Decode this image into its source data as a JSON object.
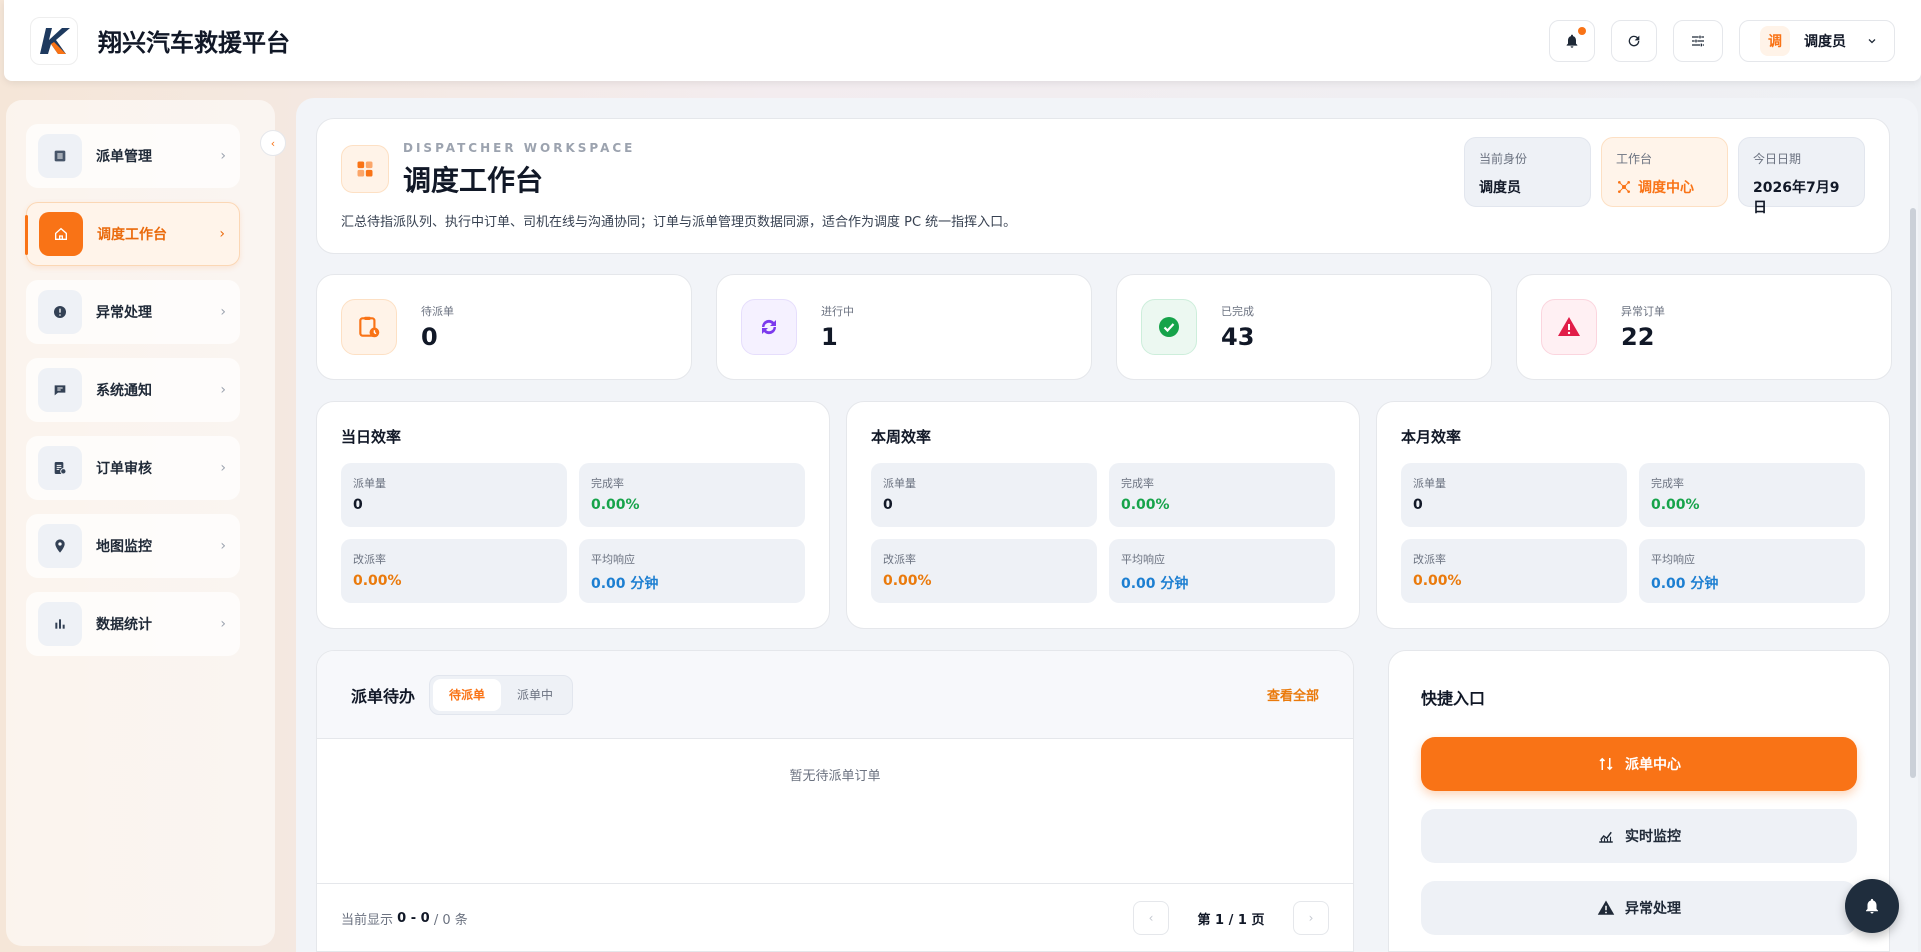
{
  "app": {
    "title": "翔兴汽车救援平台",
    "logo_text": "K"
  },
  "topbar": {
    "user_avatar": "调",
    "user_name": "调度员"
  },
  "sidebar": {
    "items": [
      {
        "label": "派单管理",
        "icon": "list-icon",
        "active": false
      },
      {
        "label": "调度工作台",
        "icon": "home-icon",
        "active": true
      },
      {
        "label": "异常处理",
        "icon": "alert-icon",
        "active": false
      },
      {
        "label": "系统通知",
        "icon": "notice-icon",
        "active": false
      },
      {
        "label": "订单审核",
        "icon": "review-icon",
        "active": false
      },
      {
        "label": "地图监控",
        "icon": "location-icon",
        "active": false
      },
      {
        "label": "数据统计",
        "icon": "bar-chart-icon",
        "active": false
      }
    ]
  },
  "header": {
    "eyebrow": "DISPATCHER WORKSPACE",
    "title": "调度工作台",
    "description": "汇总待指派队列、执行中订单、司机在线与沟通协同；订单与派单管理页数据同源，适合作为调度 PC 统一指挥入口。",
    "tiles": [
      {
        "label": "当前身份",
        "value": "调度员"
      },
      {
        "label": "工作台",
        "value": "调度中心"
      },
      {
        "label": "今日日期",
        "value": "2026年7月9日"
      }
    ]
  },
  "stats": [
    {
      "label": "待派单",
      "value": "0"
    },
    {
      "label": "进行中",
      "value": "1"
    },
    {
      "label": "已完成",
      "value": "43"
    },
    {
      "label": "异常订单",
      "value": "22"
    }
  ],
  "efficiency": [
    {
      "title": "当日效率",
      "dispatch_label": "派单量",
      "dispatch": "0",
      "complete_label": "完成率",
      "complete": "0.00%",
      "reassign_label": "改派率",
      "reassign": "0.00%",
      "response_label": "平均响应",
      "response": "0.00 分钟"
    },
    {
      "title": "本周效率",
      "dispatch_label": "派单量",
      "dispatch": "0",
      "complete_label": "完成率",
      "complete": "0.00%",
      "reassign_label": "改派率",
      "reassign": "0.00%",
      "response_label": "平均响应",
      "response": "0.00 分钟"
    },
    {
      "title": "本月效率",
      "dispatch_label": "派单量",
      "dispatch": "0",
      "complete_label": "完成率",
      "complete": "0.00%",
      "reassign_label": "改派率",
      "reassign": "0.00%",
      "response_label": "平均响应",
      "response": "0.00 分钟"
    }
  ],
  "todo": {
    "title": "派单待办",
    "tabs": [
      "待派单",
      "派单中"
    ],
    "view_all": "查看全部",
    "empty": "暂无待派单订单",
    "showing_prefix": "当前显示",
    "range": "0 - 0",
    "total": "/ 0 条",
    "page": "第 1 / 1 页"
  },
  "quick": {
    "title": "快捷入口",
    "buttons": [
      "派单中心",
      "实时监控",
      "异常处理"
    ]
  },
  "colors": {
    "accent": "#f97316",
    "success": "#16a34a",
    "info": "#1d7fd1",
    "danger": "#e11d48",
    "purple": "#7c3aed"
  }
}
